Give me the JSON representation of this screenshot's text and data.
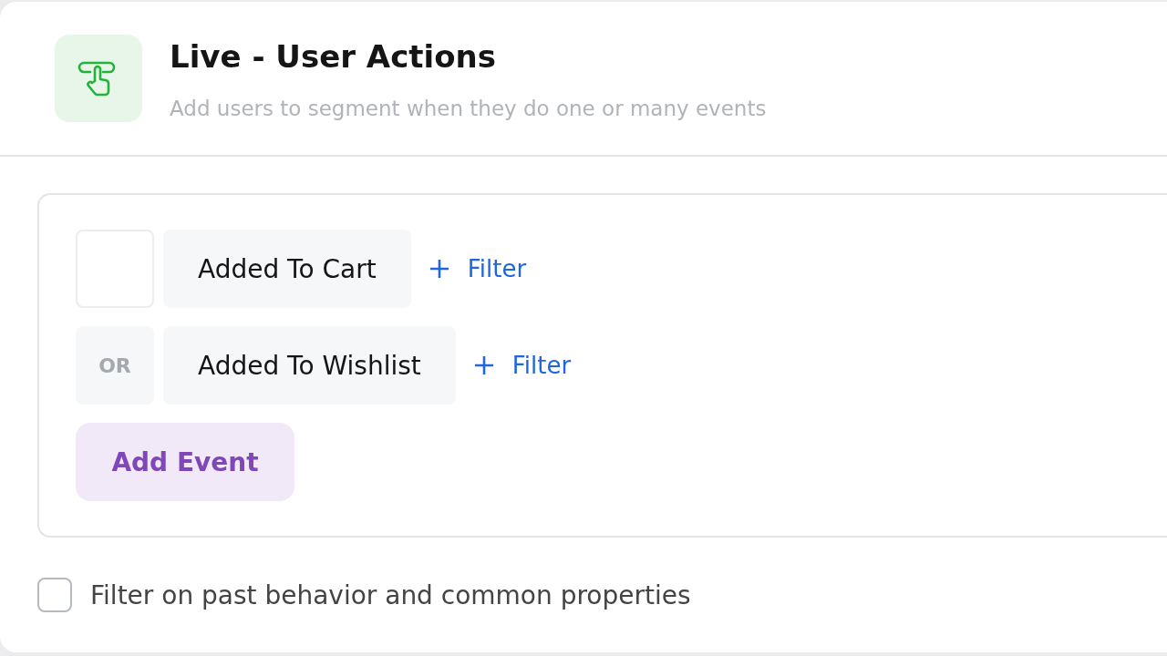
{
  "header": {
    "title": "Live - User Actions",
    "subtitle": "Add users to segment when they do one or many events"
  },
  "events": [
    {
      "name": "Added To Cart",
      "filter_label": "Filter"
    },
    {
      "connector": "OR",
      "name": "Added To Wishlist",
      "filter_label": "Filter"
    }
  ],
  "add_event_button": "Add Event",
  "past_behavior": {
    "label": "Filter on past behavior and common properties",
    "checked": false
  }
}
